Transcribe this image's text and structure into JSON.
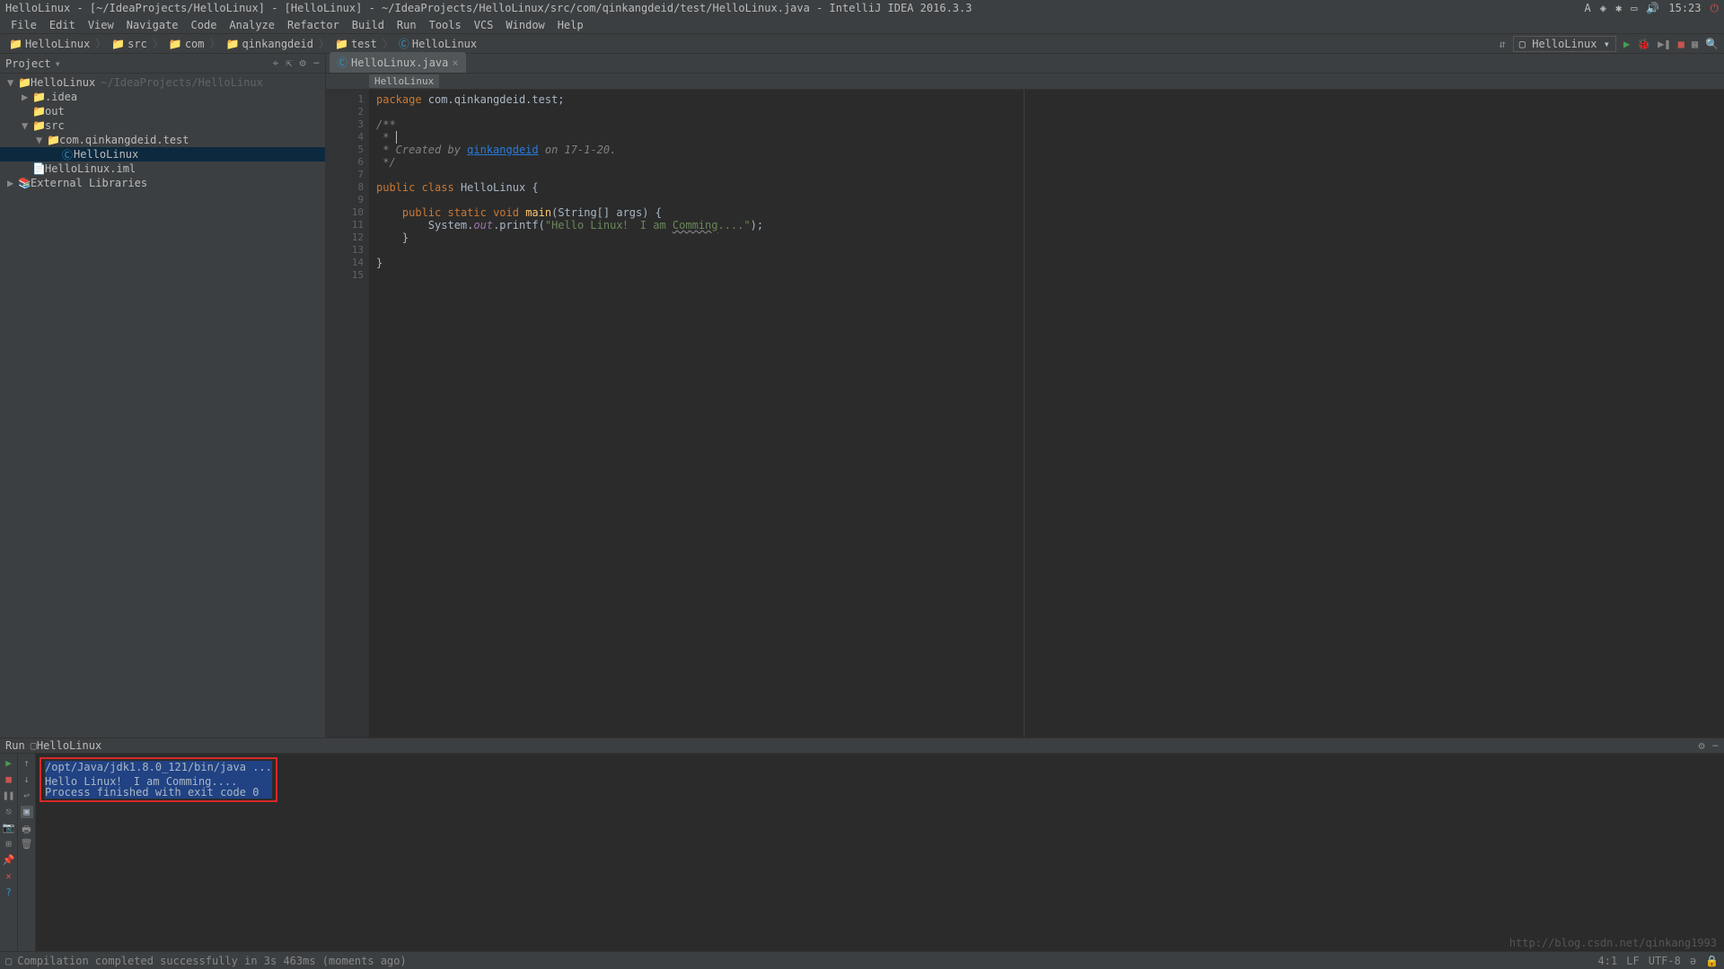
{
  "titlebar": {
    "text": "HelloLinux - [~/IdeaProjects/HelloLinux] - [HelloLinux] - ~/IdeaProjects/HelloLinux/src/com/qinkangdeid/test/HelloLinux.java - IntelliJ IDEA 2016.3.3",
    "time": "15:23"
  },
  "menubar": [
    "File",
    "Edit",
    "View",
    "Navigate",
    "Code",
    "Analyze",
    "Refactor",
    "Build",
    "Run",
    "Tools",
    "VCS",
    "Window",
    "Help"
  ],
  "breadcrumbs": [
    "HelloLinux",
    "src",
    "com",
    "qinkangdeid",
    "test",
    "HelloLinux"
  ],
  "runconfig": "HelloLinux",
  "sidebar": {
    "title": "Project",
    "items": [
      {
        "depth": 0,
        "arrow": "▼",
        "icon": "📁",
        "label": "HelloLinux",
        "dim": "~/IdeaProjects/HelloLinux",
        "color": "#8888aa"
      },
      {
        "depth": 1,
        "arrow": "▶",
        "icon": "📁",
        "label": ".idea",
        "color": "#888"
      },
      {
        "depth": 1,
        "arrow": "",
        "icon": "📁",
        "label": "out",
        "color": "#cc7832"
      },
      {
        "depth": 1,
        "arrow": "▼",
        "icon": "📁",
        "label": "src",
        "color": "#3592c4"
      },
      {
        "depth": 2,
        "arrow": "▼",
        "icon": "📁",
        "label": "com.qinkangdeid.test",
        "color": "#888"
      },
      {
        "depth": 3,
        "arrow": "",
        "icon": "Ⓒ",
        "label": "HelloLinux",
        "color": "#3592c4",
        "selected": true
      },
      {
        "depth": 1,
        "arrow": "",
        "icon": "📄",
        "label": "HelloLinux.iml",
        "color": "#888"
      },
      {
        "depth": 0,
        "arrow": "▶",
        "icon": "📚",
        "label": "External Libraries",
        "color": "#888"
      }
    ]
  },
  "editor": {
    "tab": "HelloLinux.java",
    "crumb": "HelloLinux",
    "lines": 15,
    "code": {
      "package_kw": "package",
      "package_name": " com.qinkangdeid.test;",
      "comment_created": " * Created by ",
      "comment_author": "qinkangdeid",
      "comment_date": " on 17-1-20.",
      "comment_open": "/**",
      "comment_mid": " * ",
      "comment_close": " */",
      "public_kw": "public",
      "class_kw": " class ",
      "classname": "HelloLinux {",
      "static_void": " static void ",
      "main": "main",
      "args": "(String[] args) {",
      "sysout_pre": "        System.",
      "out": "out",
      "printf": ".printf(",
      "string": "\"Hello Linux！ I am ",
      "comming": "Comming",
      "string_end": "....\"",
      "paren_end": ");",
      "brace": "    }",
      "brace2": "}"
    }
  },
  "run": {
    "header": "Run",
    "target": "HelloLinux",
    "output": [
      "/opt/Java/jdk1.8.0_121/bin/java ...",
      "Hello Linux！ I am Comming....",
      "Process finished with exit code 0"
    ]
  },
  "statusbar": {
    "msg": "Compilation completed successfully in 3s 463ms (moments ago)",
    "pos": "4:1",
    "linesep": "LF",
    "encoding": "UTF-8"
  },
  "watermark": "http://blog.csdn.net/qinkang1993"
}
